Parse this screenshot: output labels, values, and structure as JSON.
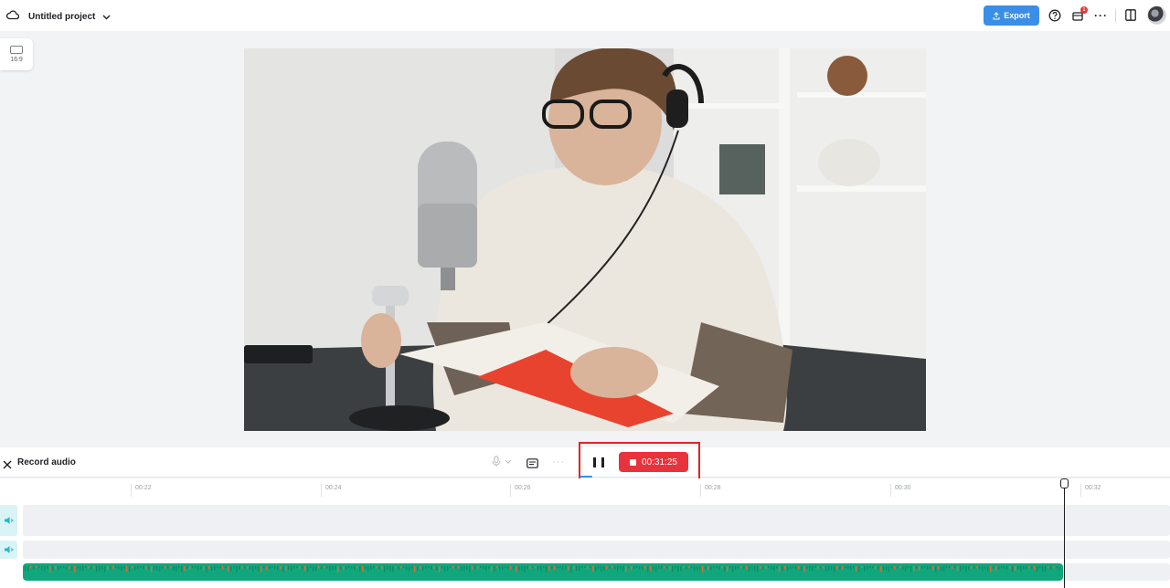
{
  "header": {
    "project_title": "Untitled project",
    "export_label": "Export",
    "notification_count": "1"
  },
  "canvas": {
    "aspect_ratio_label": "16:9"
  },
  "recorder": {
    "title": "Record audio",
    "timer": "00:31:25"
  },
  "timeline": {
    "ticks": [
      "00:22",
      "00:24",
      "00:26",
      "00:28",
      "00:30",
      "00:32"
    ]
  },
  "colors": {
    "accent": "#3a8ee6",
    "record": "#e8323c",
    "waveform": "#11a77c",
    "waveform_peak": "#e06a3b"
  }
}
